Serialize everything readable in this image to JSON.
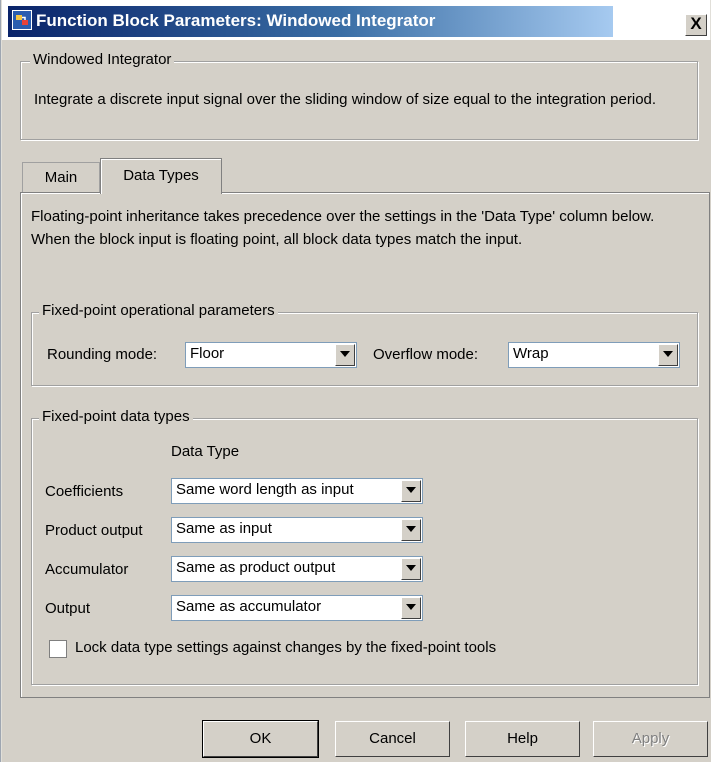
{
  "window": {
    "title": "Function Block Parameters: Windowed Integrator",
    "close_label": "X"
  },
  "description": {
    "group_label": "Windowed Integrator",
    "text": "Integrate a discrete input signal over the sliding window of size equal to the integration period."
  },
  "tabs": [
    {
      "label": "Main",
      "selected": false
    },
    {
      "label": "Data Types",
      "selected": true
    }
  ],
  "data_types_tab": {
    "intro": "Floating-point inheritance takes precedence over the settings in the 'Data Type' column below. When the block input is floating point, all block data types match the input.",
    "operational": {
      "group_label": "Fixed-point operational parameters",
      "rounding_label": "Rounding mode:",
      "rounding_value": "Floor",
      "overflow_label": "Overflow mode:",
      "overflow_value": "Wrap"
    },
    "datatypes": {
      "group_label": "Fixed-point data types",
      "column_header": "Data Type",
      "rows": [
        {
          "label": "Coefficients",
          "value": "Same word length as input"
        },
        {
          "label": "Product output",
          "value": "Same as input"
        },
        {
          "label": "Accumulator",
          "value": "Same as product output"
        },
        {
          "label": "Output",
          "value": "Same as accumulator"
        }
      ],
      "lock_label": "Lock data type settings against changes by the fixed-point tools",
      "lock_checked": false
    }
  },
  "buttons": {
    "ok": "OK",
    "cancel": "Cancel",
    "help": "Help",
    "apply": "Apply"
  }
}
